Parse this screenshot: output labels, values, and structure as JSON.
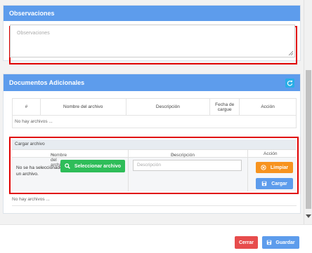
{
  "observaciones": {
    "header": "Observaciones",
    "placeholder": "Observaciones"
  },
  "documentos": {
    "header": "Documentos Adicionales",
    "refresh_icon": "refresh-icon",
    "table": {
      "columns": [
        "#",
        "Nombre del archivo",
        "Descripción",
        "Fecha de cargue",
        "Acción"
      ],
      "empty_text": "No hay archivos ..."
    },
    "upload": {
      "title": "Cargar archivo",
      "col_name": "Nombre del archivo",
      "col_desc": "Descripción",
      "col_action": "Acción",
      "no_file_text": "No se ha seleccionado un archivo.",
      "select_button": "Seleccionar archivo",
      "description_placeholder": "Descripción",
      "clear_button": "Limpiar",
      "load_button": "Cargar"
    },
    "empty_text_bottom": "No hay archivos ..."
  },
  "footer": {
    "close_button": "Cerrar",
    "save_button": "Guardar"
  },
  "colors": {
    "header_blue": "#5d9cec",
    "green": "#2ebd59",
    "orange": "#f7931e",
    "red": "#e74c4c",
    "highlight_red": "#e00000"
  }
}
